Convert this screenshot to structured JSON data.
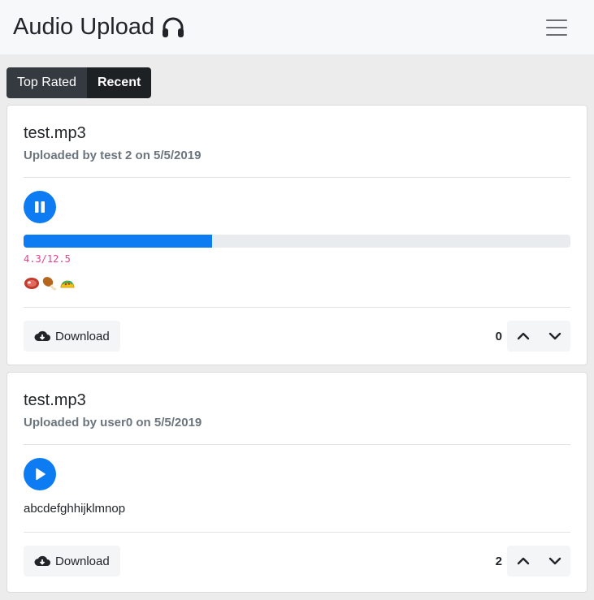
{
  "app": {
    "title": "Audio Upload",
    "title_icon": "headphones-icon"
  },
  "tabs": [
    {
      "label": "Top Rated",
      "active": false
    },
    {
      "label": "Recent",
      "active": true
    }
  ],
  "cards": [
    {
      "title": "test.mp3",
      "uploaded": "Uploaded by test 2 on 5/5/2019",
      "player_state": "playing",
      "progress": {
        "text": "4.3/12.5",
        "current": 4.3,
        "total": 12.5
      },
      "reactions": [
        "🥩",
        "🍗",
        "🌮"
      ],
      "download_label": "Download",
      "votes": "0"
    },
    {
      "title": "test.mp3",
      "uploaded": "Uploaded by user0 on 5/5/2019",
      "player_state": "paused",
      "description": "abcdefghhijklmnop",
      "download_label": "Download",
      "votes": "2"
    }
  ],
  "colors": {
    "accent": "#0d7cf2",
    "time_text": "#e83e8c",
    "muted": "#6c757d"
  }
}
